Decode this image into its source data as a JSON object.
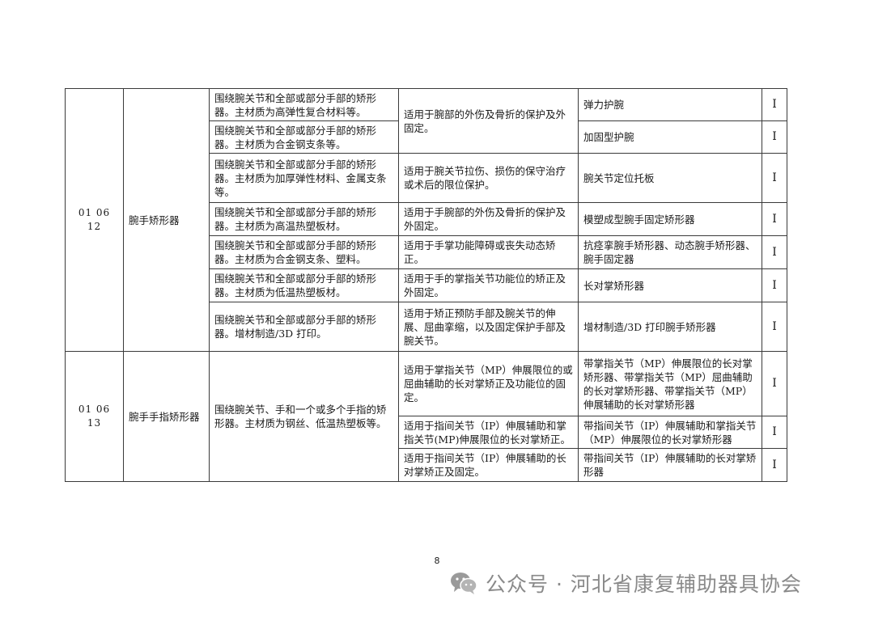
{
  "table": {
    "groups": [
      {
        "code": "01 06 12",
        "name": "腕手矫形器",
        "rows": [
          {
            "desc": "围绕腕关节和全部或部分手部的矫形器。主材质为高弹性复合材料等。",
            "usage": "适用于腕部的外伤及骨折的保护及外固定。",
            "example": "弹力护腕",
            "cls": "I"
          },
          {
            "desc": "围绕腕关节和全部或部分手部的矫形器。主材质为合金钢支条等。",
            "example": "加固型护腕",
            "cls": "I"
          },
          {
            "desc": "围绕腕关节和全部或部分手部的矫形器。主材质为加厚弹性材料、金属支条等。",
            "usage": "适用于腕关节拉伤、损伤的保守治疗或术后的限位保护。",
            "example": "腕关节定位托板",
            "cls": "I"
          },
          {
            "desc": "围绕腕关节和全部或部分手部的矫形器。主材质为高温热塑板材。",
            "usage": "适用于手腕部的外伤及骨折的保护及外固定。",
            "example": "模塑成型腕手固定矫形器",
            "cls": "I"
          },
          {
            "desc": "围绕腕关节和全部或部分手部的矫形器。主材质为合金钢支条、塑料。",
            "usage": "适用于手掌功能障碍或丧失动态矫正。",
            "example": "抗痉挛腕手矫形器、动态腕手矫形器、腕手固定器",
            "cls": "I"
          },
          {
            "desc": "围绕腕关节和全部或部分手部的矫形器。主材质为低温热塑板材。",
            "usage": "适用于手的掌指关节功能位的矫正及外固定。",
            "example": "长对掌矫形器",
            "cls": "I"
          },
          {
            "desc": "围绕腕关节和全部或部分手部的矫形器。增材制造/3D 打印。",
            "usage": "适用于矫正预防手部及腕关节的伸展、屈曲挛缩，以及固定保护手部及腕关节。",
            "example": "增材制造/3D 打印腕手矫形器",
            "cls": "I"
          }
        ]
      },
      {
        "code": "01 06 13",
        "name": "腕手手指矫形器",
        "desc": "围绕腕关节、手和一个或多个手指的矫形器。主材质为钢丝、低温热塑板等。",
        "rows": [
          {
            "usage": "适用于掌指关节（MP）伸展限位的或屈曲辅助的长对掌矫正及功能位的固定。",
            "example": "带掌指关节（MP）伸展限位的长对掌矫形器、带掌指关节（MP）屈曲辅助的长对掌矫形器、带掌指关节（MP）伸展辅助的长对掌矫形器",
            "cls": "I"
          },
          {
            "usage": "适用于指间关节（IP）伸展辅助和掌指关节(MP)伸展限位的长对掌矫正。",
            "example": "带指间关节（IP）伸展辅助和掌指关节（MP）伸展限位的长对掌矫形器",
            "cls": "I"
          },
          {
            "usage": "适用于指间关节（IP）伸展辅助的长对掌矫正及固定。",
            "example": "带指间关节（IP）伸展辅助的长对掌矫形器",
            "cls": "I"
          }
        ]
      }
    ]
  },
  "page_number": "8",
  "watermark": {
    "icon": "wechat-icon",
    "text": "公众号 · 河北省康复辅助器具协会"
  }
}
